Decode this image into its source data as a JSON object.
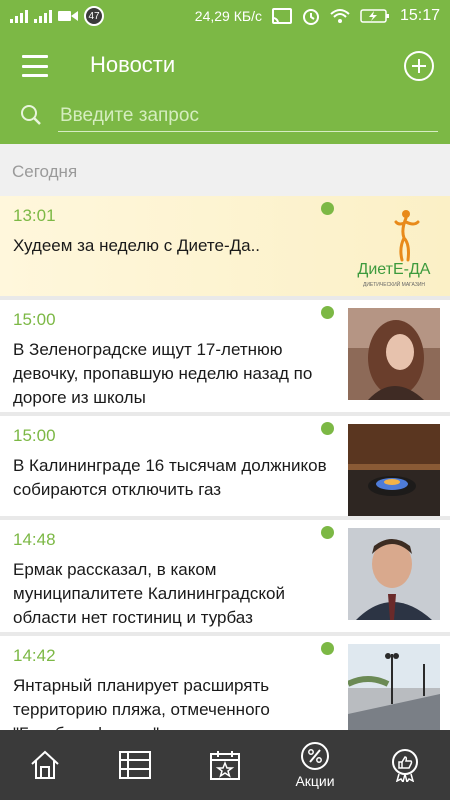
{
  "status_bar": {
    "notification_count": "47",
    "network_speed": "24,29 КБ/с",
    "clock": "15:17"
  },
  "header": {
    "title": "Новости",
    "search_placeholder": "Введите запрос"
  },
  "feed": {
    "section_label": "Сегодня",
    "items": [
      {
        "time": "13:01",
        "title": "Худеем за неделю с Диете-Да..",
        "unread": true,
        "thumb": "diete-da-logo"
      },
      {
        "time": "15:00",
        "title": "В Зеленоградске ищут 17-летнюю девочку, пропавшую неделю назад по дороге из школы",
        "unread": true,
        "thumb": "girl-photo"
      },
      {
        "time": "15:00",
        "title": "В Калининграде 16 тысячам должников собираются отключить газ",
        "unread": true,
        "thumb": "gas-stove-photo"
      },
      {
        "time": "14:48",
        "title": "Ермак рассказал, в каком муниципалитете Калининградской области нет гостиниц и турбаз",
        "unread": true,
        "thumb": "man-portrait-photo"
      },
      {
        "time": "14:42",
        "title": "Янтарный планирует расширять территорию пляжа, отмеченного \"Голубым флагом\"",
        "unread": true,
        "thumb": "beach-promenade-photo"
      }
    ],
    "promo_logo": {
      "brand": "ДиетЕ-ДА",
      "tagline": "ДИЕТИЧЕСКИЙ МАГАЗИН"
    }
  },
  "bottom_nav": {
    "items": [
      {
        "icon": "home-icon",
        "label": ""
      },
      {
        "icon": "list-icon",
        "label": ""
      },
      {
        "icon": "calendar-star-icon",
        "label": ""
      },
      {
        "icon": "percent-icon",
        "label": "Акции"
      },
      {
        "icon": "thumbs-up-badge-icon",
        "label": ""
      }
    ]
  },
  "colors": {
    "accent_green": "#7cb845",
    "nav_background": "#3a3a3a",
    "promo_background": "#fbf0c6"
  }
}
